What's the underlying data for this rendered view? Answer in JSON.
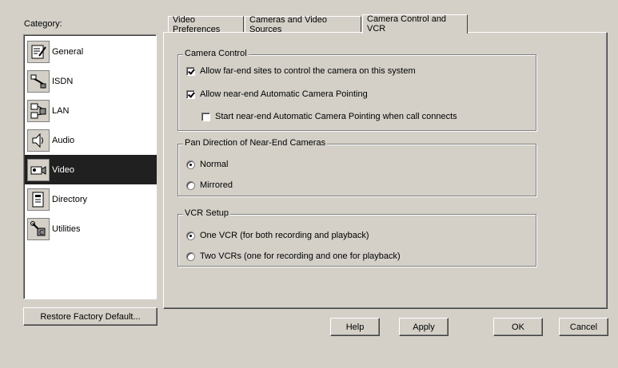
{
  "category_label": "Category:",
  "categories": [
    {
      "label": "General",
      "icon": "general-icon"
    },
    {
      "label": "ISDN",
      "icon": "isdn-icon"
    },
    {
      "label": "LAN",
      "icon": "lan-icon"
    },
    {
      "label": "Audio",
      "icon": "audio-icon"
    },
    {
      "label": "Video",
      "icon": "video-icon",
      "selected": true
    },
    {
      "label": "Directory",
      "icon": "directory-icon"
    },
    {
      "label": "Utilities",
      "icon": "utilities-icon"
    }
  ],
  "restore_button": "Restore Factory Default...",
  "tabs": [
    {
      "label": "Video Preferences"
    },
    {
      "label": "Cameras and Video Sources"
    },
    {
      "label": "Camera Control and VCR",
      "active": true
    }
  ],
  "camera_control": {
    "title": "Camera Control",
    "allow_far_end": {
      "label": "Allow far-end sites to control the camera on this system",
      "checked": true
    },
    "allow_near_end": {
      "label": "Allow near-end Automatic Camera Pointing",
      "checked": true
    },
    "start_near_end": {
      "label": "Start near-end Automatic Camera Pointing when call connects",
      "checked": false
    }
  },
  "pan_direction": {
    "title": "Pan Direction of Near-End Cameras",
    "options": [
      {
        "label": "Normal",
        "checked": true
      },
      {
        "label": "Mirrored",
        "checked": false
      }
    ]
  },
  "vcr_setup": {
    "title": "VCR Setup",
    "options": [
      {
        "label": "One VCR (for both recording and playback)",
        "checked": true
      },
      {
        "label": "Two VCRs (one for recording and one for playback)",
        "checked": false
      }
    ]
  },
  "buttons": {
    "help": "Help",
    "apply": "Apply",
    "ok": "OK",
    "cancel": "Cancel"
  },
  "colors": {
    "face": "#d4d0c8",
    "selected_bg": "#202020"
  }
}
